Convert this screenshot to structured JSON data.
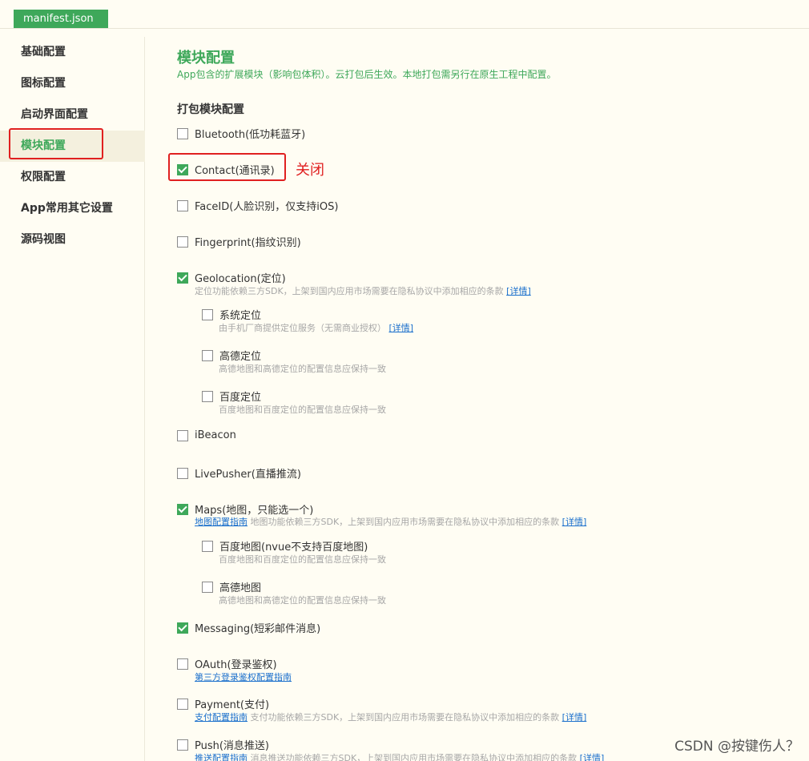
{
  "tab": {
    "label": "manifest.json"
  },
  "sidebar": {
    "items": [
      {
        "label": "基础配置"
      },
      {
        "label": "图标配置"
      },
      {
        "label": "启动界面配置"
      },
      {
        "label": "模块配置"
      },
      {
        "label": "权限配置"
      },
      {
        "label": "App常用其它设置"
      },
      {
        "label": "源码视图"
      }
    ],
    "active_index": 3
  },
  "main": {
    "title": "模块配置",
    "description": "App包含的扩展模块（影响包体积）。云打包后生效。本地打包需另行在原生工程中配置。",
    "section_title": "打包模块配置",
    "modules": {
      "bluetooth": {
        "label": "Bluetooth(低功耗蓝牙)",
        "checked": false
      },
      "contact": {
        "label": "Contact(通讯录)",
        "checked": true
      },
      "faceid": {
        "label": "FaceID(人脸识别，仅支持iOS)",
        "checked": false
      },
      "fingerprint": {
        "label": "Fingerprint(指纹识别)",
        "checked": false
      },
      "geolocation": {
        "label": "Geolocation(定位)",
        "checked": true,
        "desc": "定位功能依赖三方SDK，上架到国内应用市场需要在隐私协议中添加相应的条款",
        "link": "[详情]",
        "sub": {
          "system": {
            "label": "系统定位",
            "checked": false,
            "desc": "由手机厂商提供定位服务（无需商业授权）",
            "link": "[详情]"
          },
          "amap": {
            "label": "高德定位",
            "checked": false,
            "desc": "高德地图和高德定位的配置信息应保持一致"
          },
          "baidu": {
            "label": "百度定位",
            "checked": false,
            "desc": "百度地图和百度定位的配置信息应保持一致"
          }
        }
      },
      "ibeacon": {
        "label": "iBeacon",
        "checked": false
      },
      "livepusher": {
        "label": "LivePusher(直播推流)",
        "checked": false
      },
      "maps": {
        "label": "Maps(地图，只能选一个)",
        "checked": true,
        "guide_link": "地图配置指南",
        "desc": "地图功能依赖三方SDK，上架到国内应用市场需要在隐私协议中添加相应的条款",
        "link": "[详情]",
        "sub": {
          "baidu": {
            "label": "百度地图(nvue不支持百度地图)",
            "checked": false,
            "desc": "百度地图和百度定位的配置信息应保持一致"
          },
          "amap": {
            "label": "高德地图",
            "checked": false,
            "desc": "高德地图和高德定位的配置信息应保持一致"
          }
        }
      },
      "messaging": {
        "label": "Messaging(短彩邮件消息)",
        "checked": true
      },
      "oauth": {
        "label": "OAuth(登录鉴权)",
        "checked": false,
        "guide_link": "第三方登录鉴权配置指南"
      },
      "payment": {
        "label": "Payment(支付)",
        "checked": false,
        "guide_link": "支付配置指南",
        "desc": "支付功能依赖三方SDK，上架到国内应用市场需要在隐私协议中添加相应的条款",
        "link": "[详情]"
      },
      "push": {
        "label": "Push(消息推送)",
        "checked": false,
        "guide_link": "推送配置指南",
        "desc": "消息推送功能依赖三方SDK，上架到国内应用市场需要在隐私协议中添加相应的条款",
        "link": "[详情]"
      }
    }
  },
  "annotation": {
    "text": "关闭"
  },
  "watermark": "CSDN @按键伤人？",
  "colors": {
    "accent": "#3ea85a",
    "annotation": "#e02020",
    "link": "#1a6fcc",
    "background": "#fffdf3"
  }
}
